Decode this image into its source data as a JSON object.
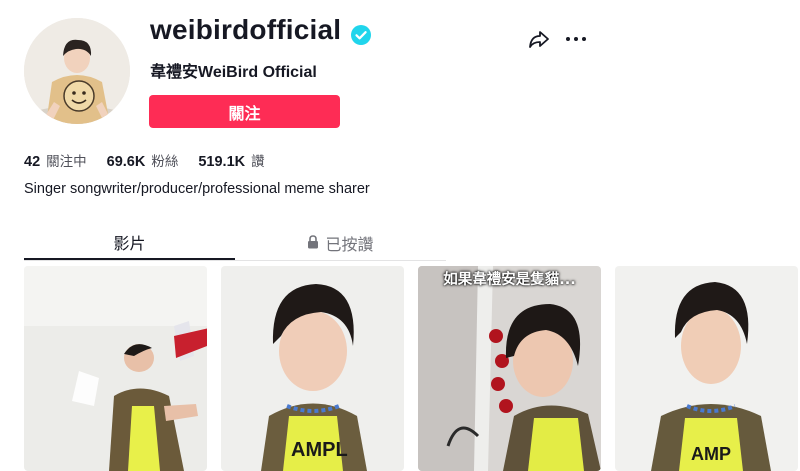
{
  "profile": {
    "username": "weibirdofficial",
    "nickname": "韋禮安WeiBird Official",
    "follow_label": "關注",
    "bio": "Singer songwriter/producer/professional meme sharer",
    "verified_icon": "verified-check-icon"
  },
  "stats": {
    "following": {
      "value": "42",
      "label": "關注中"
    },
    "followers": {
      "value": "69.6K",
      "label": "粉絲"
    },
    "likes": {
      "value": "519.1K",
      "label": "讚"
    }
  },
  "actions": {
    "share_icon": "share-arrow-icon",
    "more_icon": "more-dots-icon"
  },
  "tabs": [
    {
      "label": "影片",
      "active": true
    },
    {
      "label": "已按讚",
      "locked": true
    }
  ],
  "videos": [
    {
      "caption": ""
    },
    {
      "caption": ""
    },
    {
      "caption": "如果韋禮安是隻貓..."
    },
    {
      "caption": ""
    }
  ],
  "colors": {
    "accent": "#fe2c55",
    "verified": "#20d5ec",
    "text": "#161823",
    "muted": "#73747b"
  }
}
